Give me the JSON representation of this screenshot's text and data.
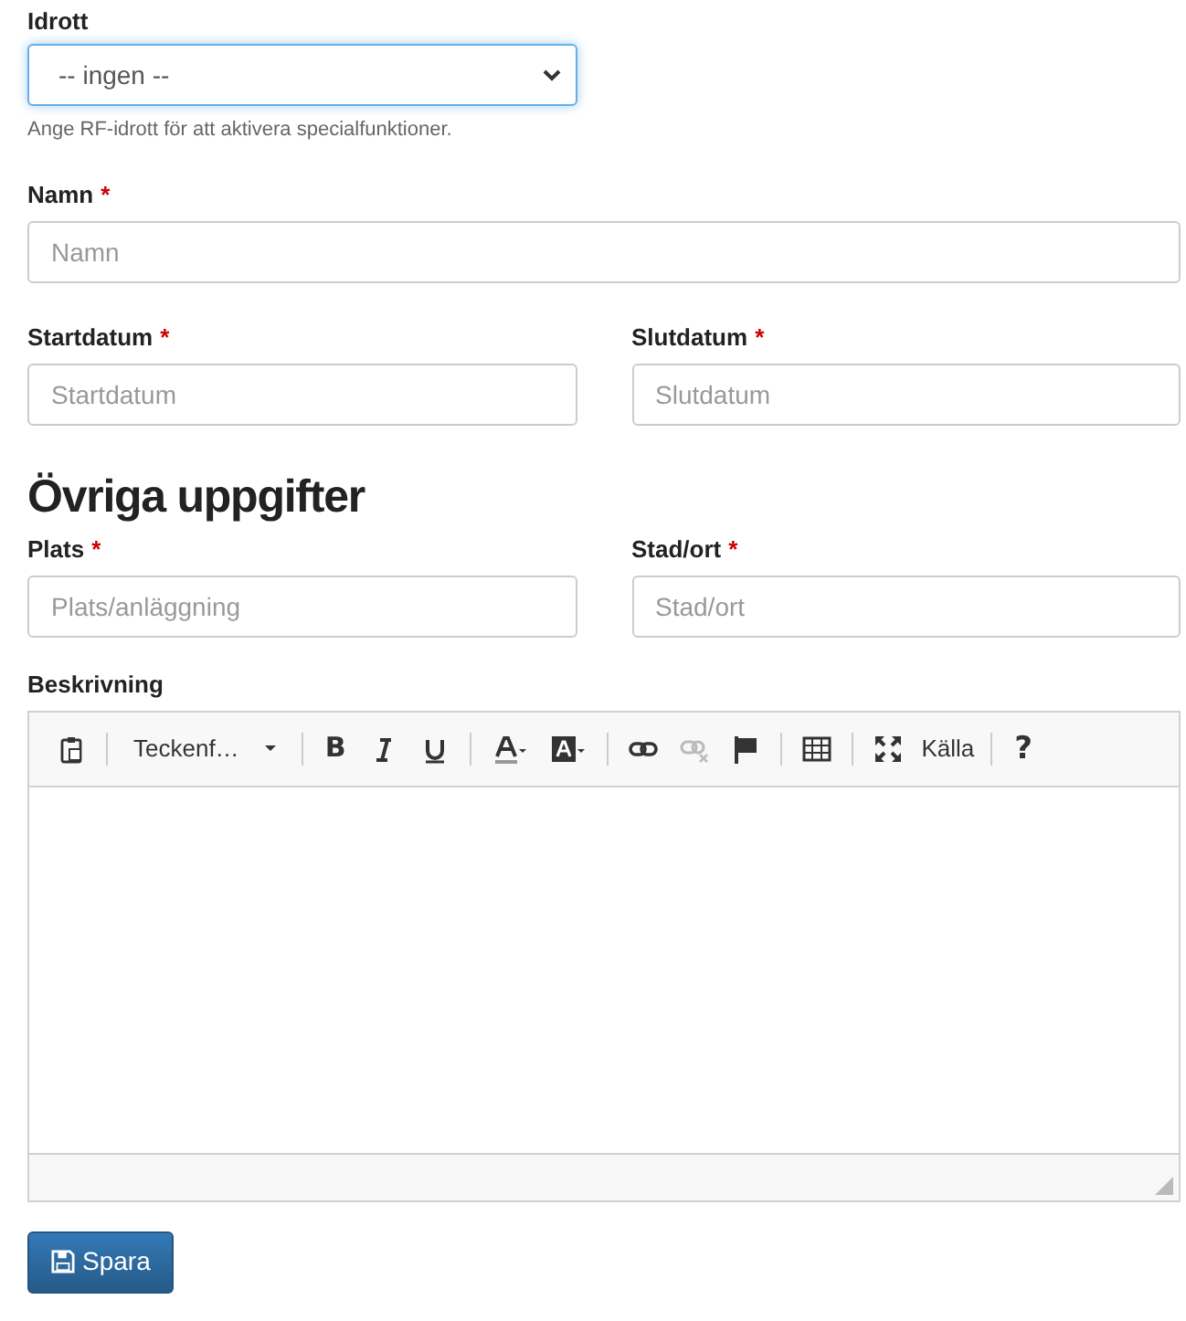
{
  "sport": {
    "label": "Idrott",
    "value": "-- ingen --",
    "focused": true,
    "help": "Ange RF-idrott för att aktivera specialfunktioner."
  },
  "name_field": {
    "label": "Namn",
    "required_mark": "*",
    "placeholder": "Namn"
  },
  "date_fields": [
    {
      "label": "Startdatum",
      "required_mark": "*",
      "placeholder": "Startdatum"
    },
    {
      "label": "Slutdatum",
      "required_mark": "*",
      "placeholder": "Slutdatum"
    }
  ],
  "section_heading": "Övriga uppgifter",
  "place_fields": [
    {
      "label": "Plats",
      "required_mark": "*",
      "placeholder": "Plats/anläggning"
    },
    {
      "label": "Stad/ort",
      "required_mark": "*",
      "placeholder": "Stad/ort"
    }
  ],
  "editor": {
    "label": "Beskrivning",
    "toolbar": [
      {
        "kind": "icon",
        "disabled": false
      },
      {
        "kind": "separator"
      },
      {
        "kind": "dropdown",
        "text": "Teckenf…",
        "disabled": false
      },
      {
        "kind": "separator"
      },
      {
        "kind": "glyph",
        "text": "B",
        "disabled": false
      },
      {
        "kind": "icon",
        "disabled": false
      },
      {
        "kind": "icon",
        "disabled": false
      },
      {
        "kind": "separator"
      },
      {
        "kind": "icon",
        "disabled": false
      },
      {
        "kind": "icon",
        "disabled": false
      },
      {
        "kind": "separator"
      },
      {
        "kind": "icon",
        "disabled": false
      },
      {
        "kind": "icon",
        "disabled": true
      },
      {
        "kind": "icon",
        "disabled": false
      },
      {
        "kind": "separator"
      },
      {
        "kind": "icon",
        "disabled": false
      },
      {
        "kind": "separator"
      },
      {
        "kind": "icon",
        "disabled": false
      },
      {
        "kind": "text",
        "text": "Källa",
        "disabled": false
      },
      {
        "kind": "separator"
      },
      {
        "kind": "glyph",
        "text": "?",
        "disabled": false
      }
    ]
  },
  "save_button": "Spara"
}
